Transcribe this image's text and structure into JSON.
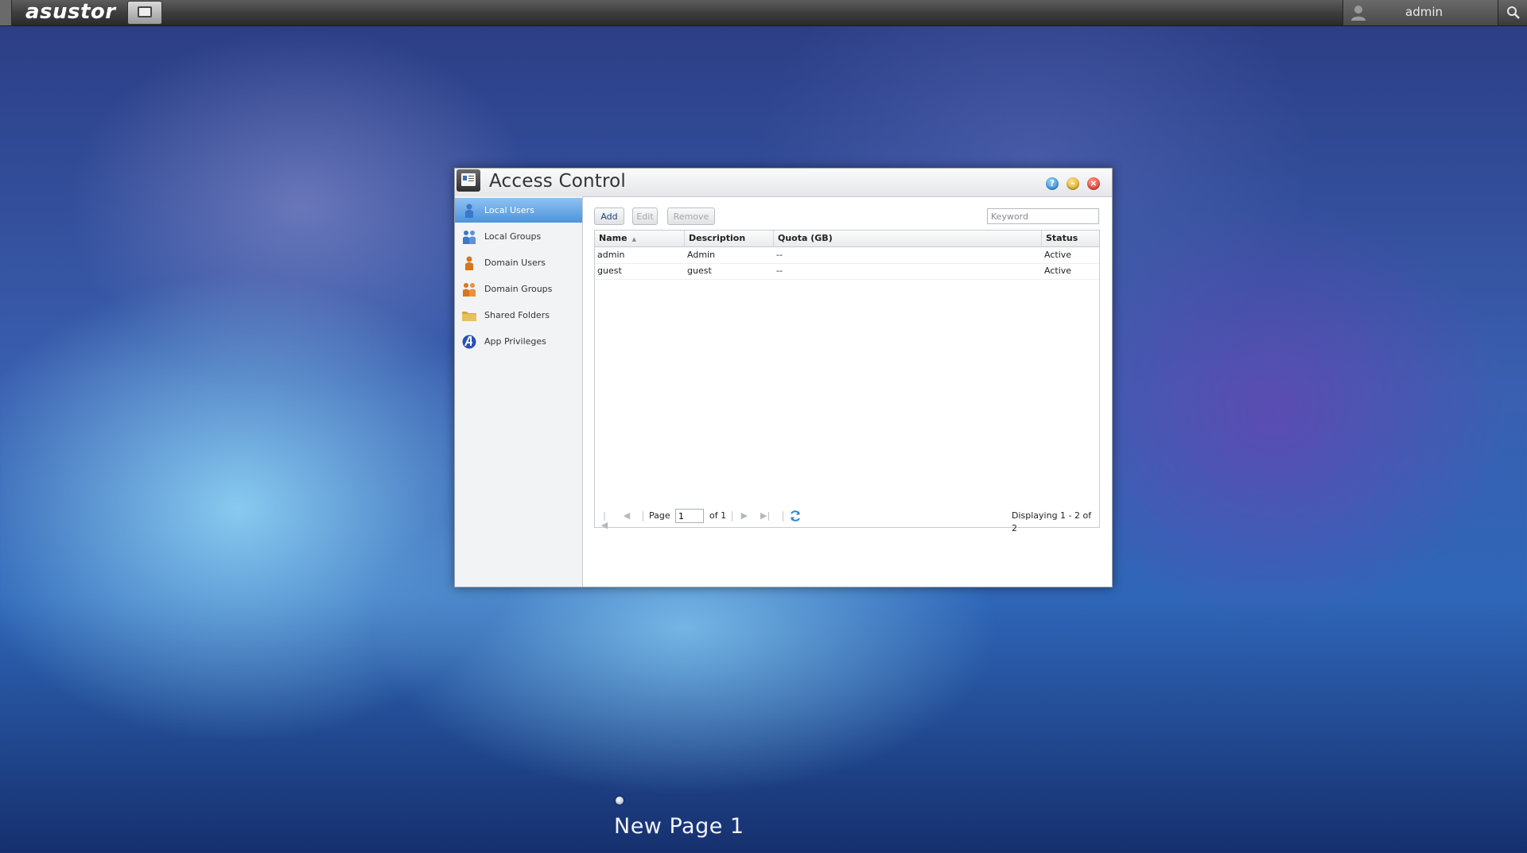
{
  "topbar": {
    "logo": "asustor",
    "user_name": "admin"
  },
  "window": {
    "title": "Access Control",
    "controls": {
      "help": "?",
      "minimize": "–",
      "close": "×"
    }
  },
  "sidebar": {
    "items": [
      {
        "label": "Local Users",
        "icon": "user-icon",
        "active": true
      },
      {
        "label": "Local Groups",
        "icon": "group-icon",
        "active": false
      },
      {
        "label": "Domain Users",
        "icon": "domain-user-icon",
        "active": false
      },
      {
        "label": "Domain Groups",
        "icon": "domain-group-icon",
        "active": false
      },
      {
        "label": "Shared Folders",
        "icon": "folder-icon",
        "active": false
      },
      {
        "label": "App Privileges",
        "icon": "app-privileges-icon",
        "active": false
      }
    ]
  },
  "toolbar": {
    "add_label": "Add",
    "edit_label": "Edit",
    "remove_label": "Remove",
    "search_placeholder": "Keyword"
  },
  "table": {
    "columns": [
      "Name",
      "Description",
      "Quota (GB)",
      "Status"
    ],
    "rows": [
      [
        "admin",
        "Admin",
        "--",
        "Active"
      ],
      [
        "guest",
        "guest",
        "--",
        "Active"
      ]
    ]
  },
  "pager": {
    "page_label": "Page",
    "page_value": "1",
    "of_label": "of 1",
    "display_text": "Displaying 1 - 2 of 2"
  },
  "desktop": {
    "page_name": "New Page 1"
  },
  "colors": {
    "accent": "#4c94dc",
    "title_text": "#333333"
  }
}
